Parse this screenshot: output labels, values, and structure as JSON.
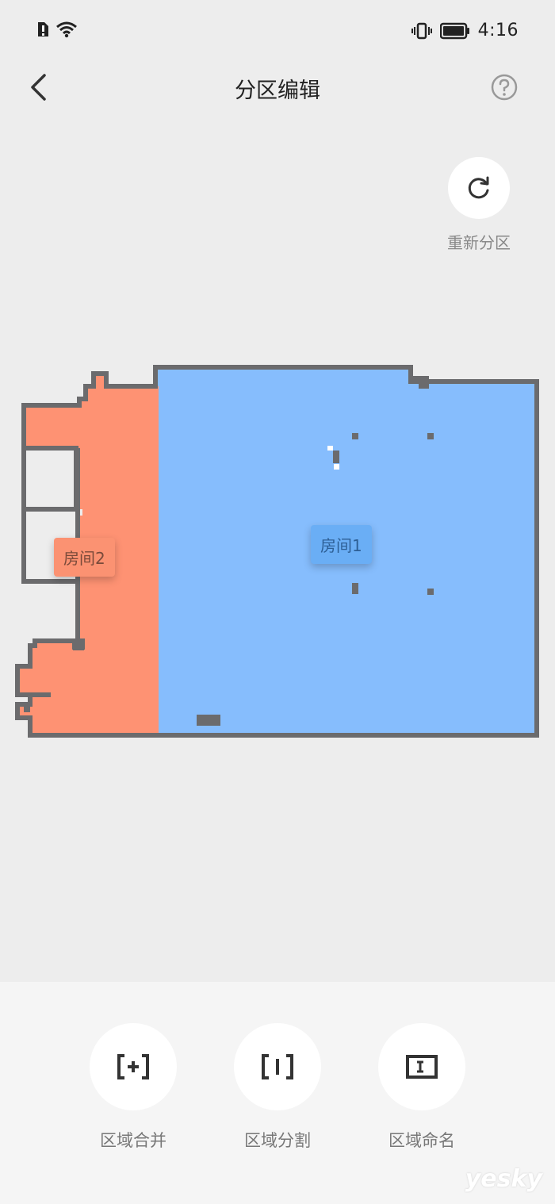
{
  "status_bar": {
    "time": "4:16"
  },
  "header": {
    "title": "分区编辑"
  },
  "repartition": {
    "label": "重新分区"
  },
  "map": {
    "rooms": [
      {
        "label": "房间1",
        "color": "#86bdfd"
      },
      {
        "label": "房间2",
        "color": "#fe9273"
      }
    ],
    "wall_color": "#6b6b6d"
  },
  "tools": [
    {
      "label": "区域合并",
      "icon": "merge-icon"
    },
    {
      "label": "区域分割",
      "icon": "split-icon"
    },
    {
      "label": "区域命名",
      "icon": "rename-icon"
    }
  ],
  "watermark": "yesky"
}
